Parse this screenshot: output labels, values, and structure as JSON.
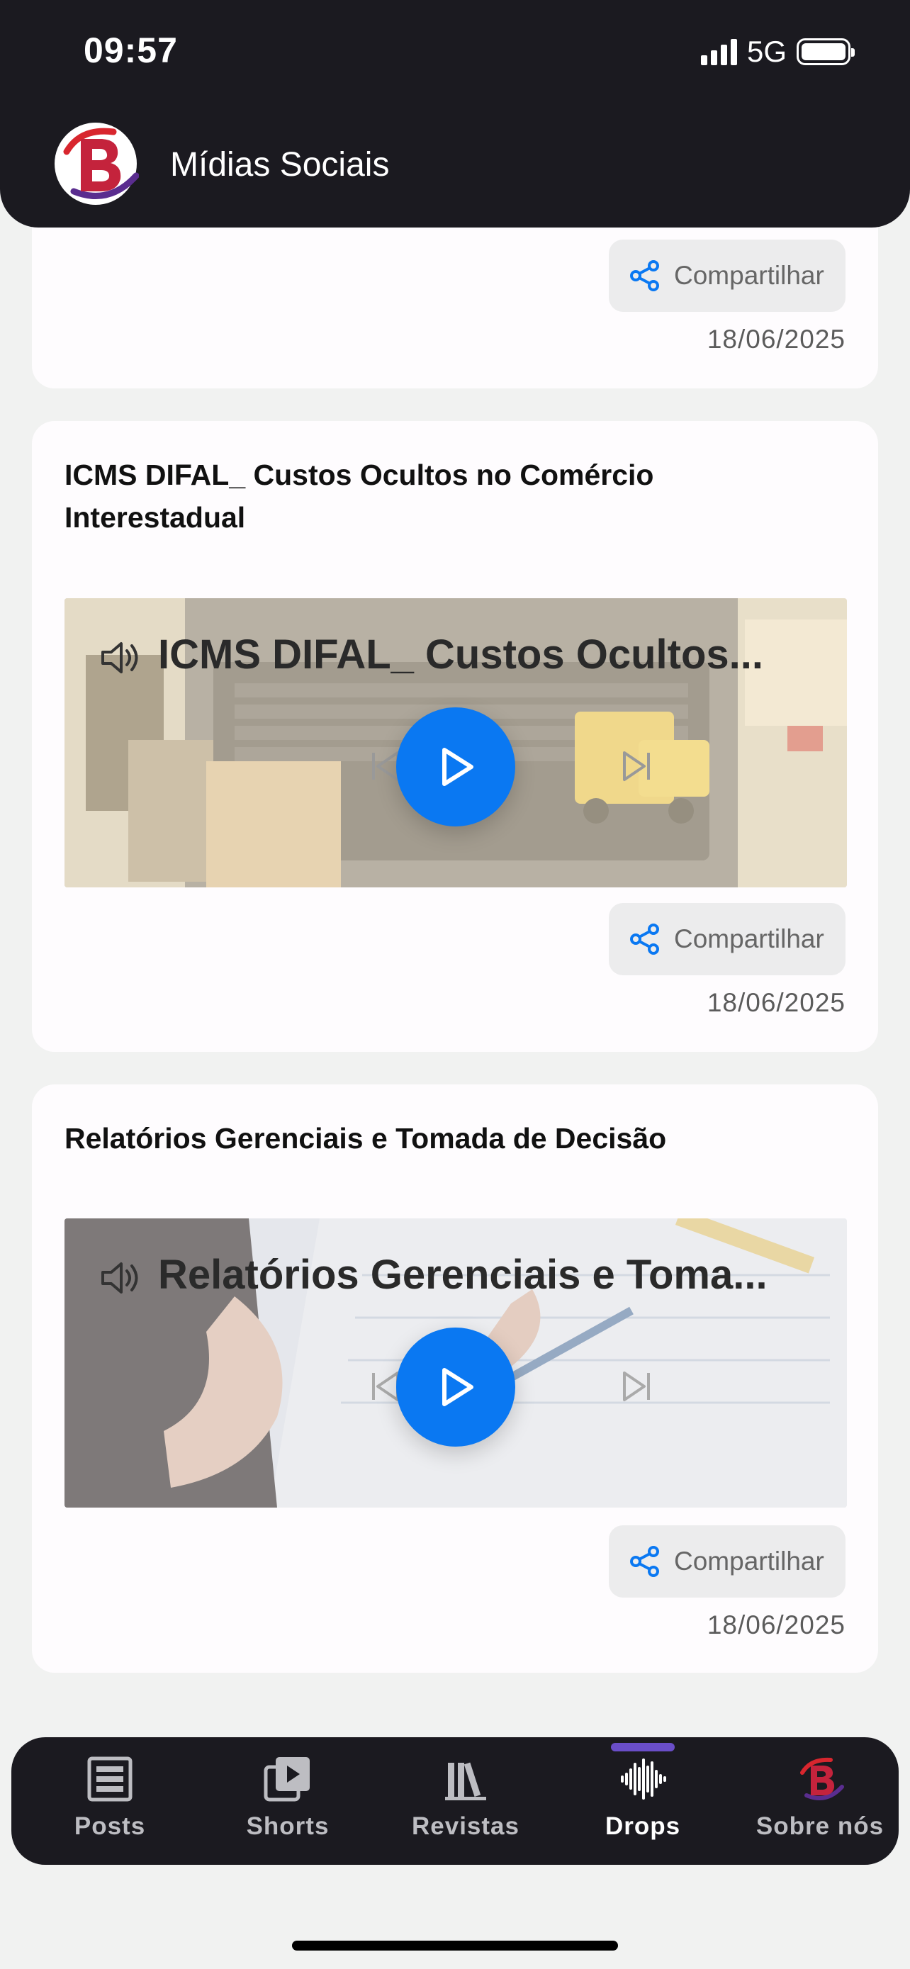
{
  "status_bar": {
    "time": "09:57",
    "network": "5G"
  },
  "header": {
    "title": "Mídias Sociais",
    "logo_letter": "B"
  },
  "posts": [
    {
      "title": "",
      "media_title": "",
      "share_label": "Compartilhar",
      "date": "18/06/2025"
    },
    {
      "title": "ICMS DIFAL_ Custos Ocultos no Comércio Interestadual",
      "media_title": "ICMS DIFAL_ Custos Ocultos...",
      "share_label": "Compartilhar",
      "date": "18/06/2025"
    },
    {
      "title": "Relatórios Gerenciais e Tomada de Decisão",
      "media_title": "Relatórios Gerenciais e Toma...",
      "share_label": "Compartilhar",
      "date": "18/06/2025"
    }
  ],
  "tabs": [
    {
      "label": "Posts",
      "icon": "posts-icon",
      "active": false
    },
    {
      "label": "Shorts",
      "icon": "shorts-icon",
      "active": false
    },
    {
      "label": "Revistas",
      "icon": "revistas-icon",
      "active": false
    },
    {
      "label": "Drops",
      "icon": "drops-icon",
      "active": true
    },
    {
      "label": "Sobre nós",
      "icon": "logo-icon",
      "active": false
    }
  ],
  "colors": {
    "accent": "#0a78f2",
    "header_bg": "#1b1a20",
    "active_tab_indicator": "#6a4ec8"
  }
}
